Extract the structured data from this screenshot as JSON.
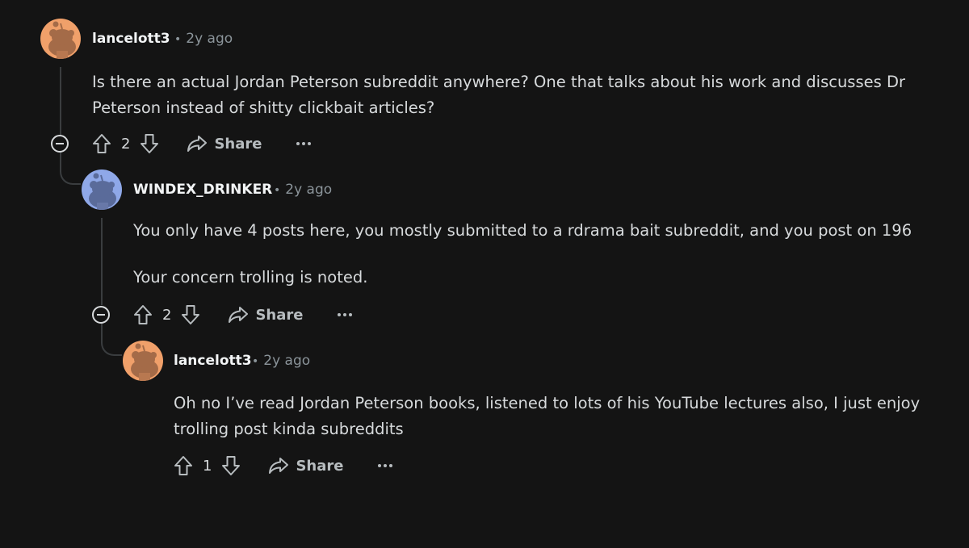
{
  "comments": [
    {
      "username": "lancelott3",
      "time": "2y ago",
      "separator": "•",
      "avatar_color": "#f0a06a",
      "body": "Is there an actual Jordan Peterson subreddit anywhere? One that talks about his work and discusses Dr Peterson instead of shitty clickbait articles?",
      "votes": "2",
      "share_label": "Share",
      "more_icon": "ellipsis-icon"
    },
    {
      "username": "WINDEX_DRINKER",
      "time": "2y ago",
      "separator": "•",
      "avatar_color": "#8fa8e8",
      "body_lines": [
        "You only have 4 posts here, you mostly submitted to a rdrama bait subreddit, and you post on 196",
        "Your concern trolling is noted."
      ],
      "votes": "2",
      "share_label": "Share",
      "more_icon": "ellipsis-icon"
    },
    {
      "username": "lancelott3",
      "time": "2y ago",
      "separator": "•",
      "avatar_color": "#f0a06a",
      "body": "Oh no I’ve read Jordan Peterson books, listened to lots of his YouTube lectures also, I just enjoy trolling post kinda subreddits",
      "votes": "1",
      "share_label": "Share",
      "more_icon": "ellipsis-icon"
    }
  ],
  "icons": {
    "upvote": "upvote-arrow-icon",
    "downvote": "downvote-arrow-icon",
    "share": "share-arrow-icon",
    "collapse": "collapse-minus-icon",
    "avatar": "snoo-avatar-icon"
  },
  "colors": {
    "background": "#141414",
    "text": "#d7dadc",
    "muted": "#8b949a",
    "thread_line": "#3a3d3f"
  }
}
